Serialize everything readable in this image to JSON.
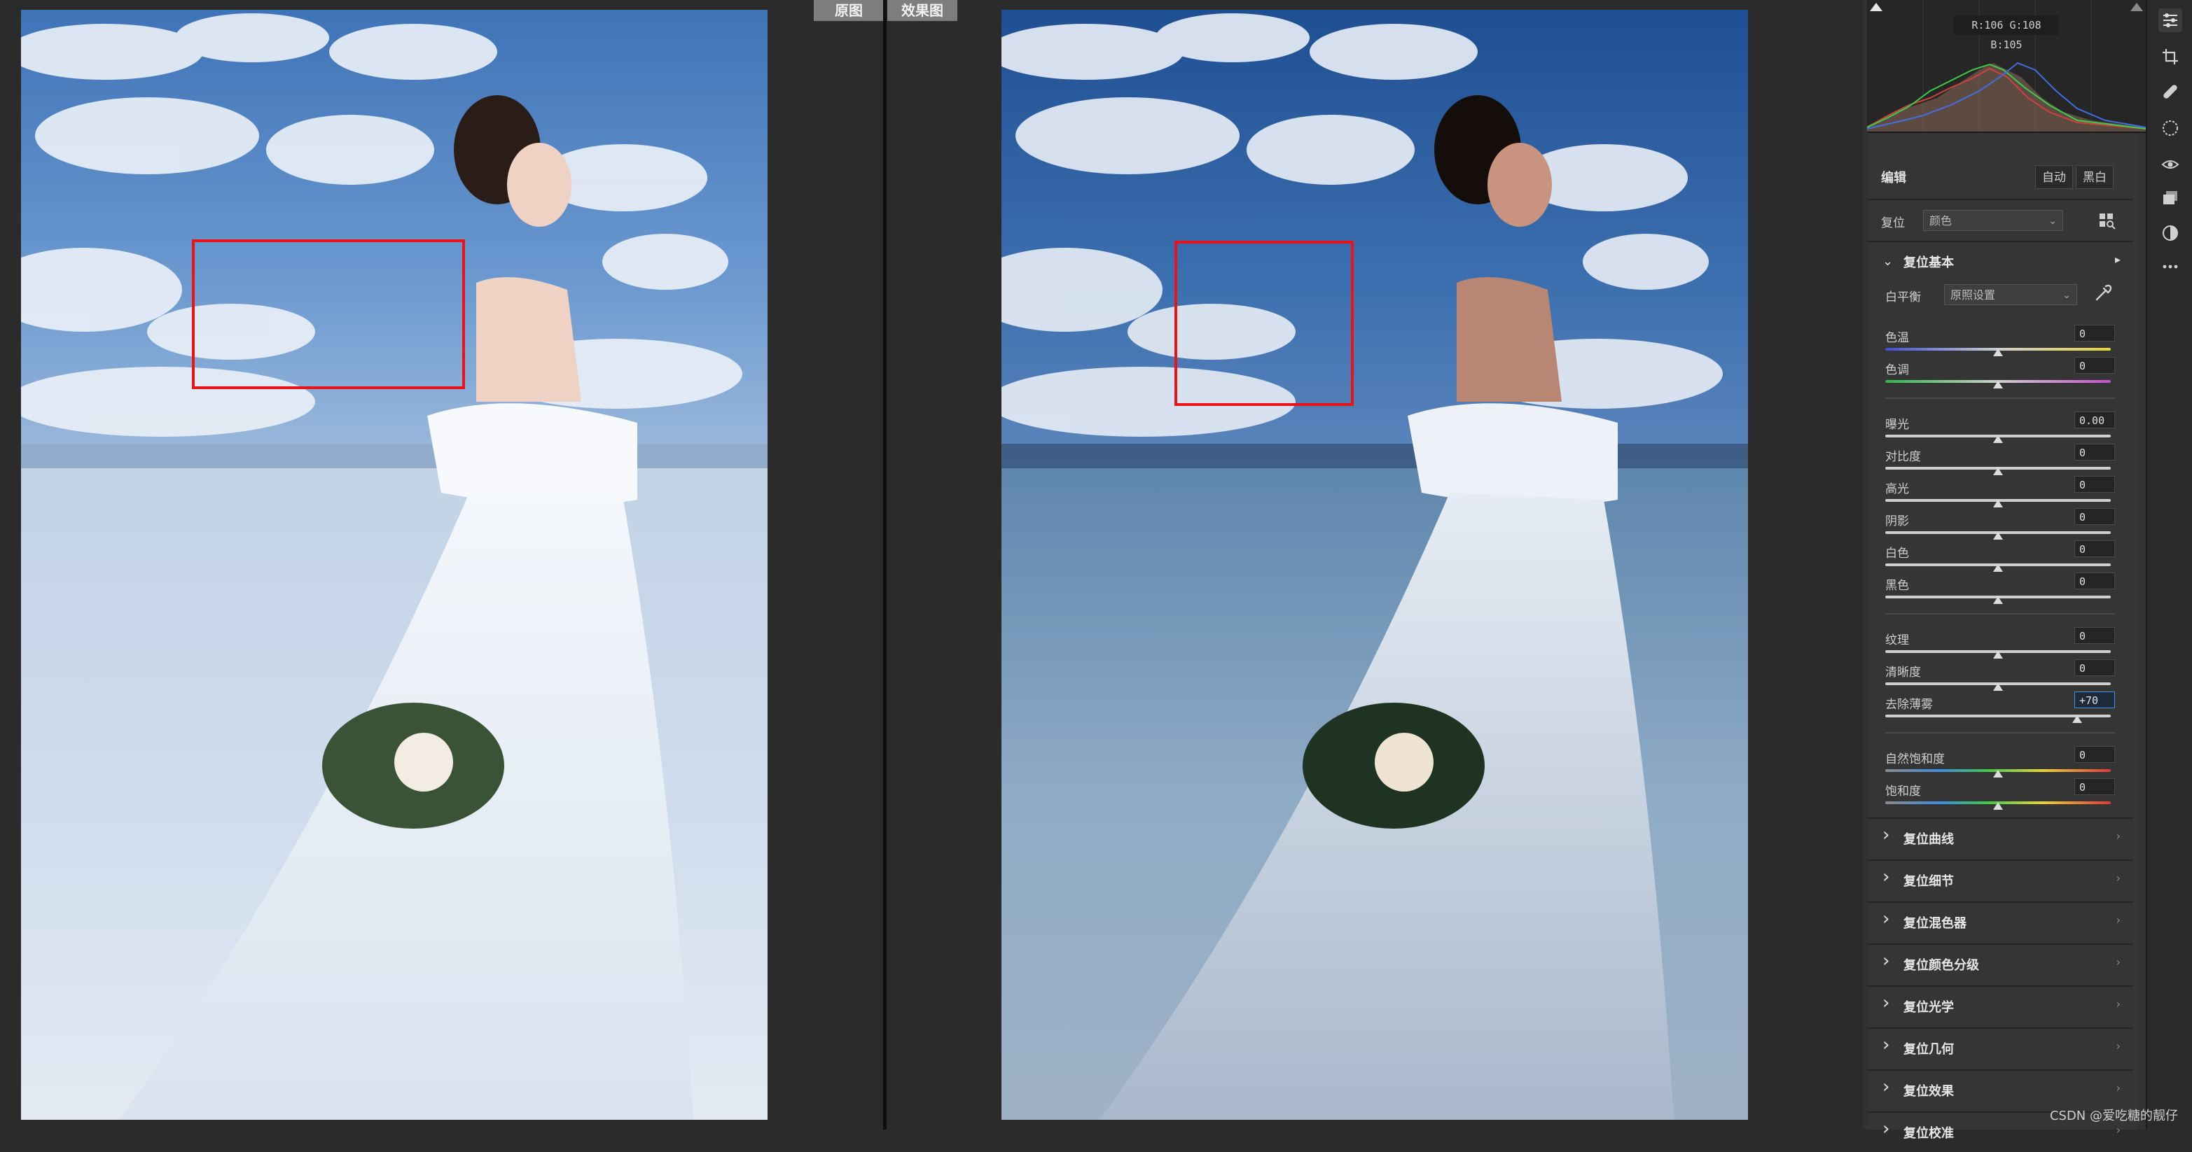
{
  "view": {
    "before_label": "原图",
    "after_label": "效果图"
  },
  "histogram": {
    "rgb_readout": "R:106  G:108  B:105"
  },
  "edit": {
    "title": "编辑",
    "auto_label": "自动",
    "bw_label": "黑白"
  },
  "profile": {
    "label": "复位",
    "value": "颜色"
  },
  "basic": {
    "title": "复位基本",
    "wb_label": "白平衡",
    "wb_value": "原照设置",
    "sliders": [
      {
        "label": "色温",
        "value": "0",
        "level": 0.5,
        "gradient": "temp"
      },
      {
        "label": "色调",
        "value": "0",
        "level": 0.5,
        "gradient": "tint"
      },
      {
        "label": "曝光",
        "value": "0.00",
        "level": 0.5,
        "gradient": "none"
      },
      {
        "label": "对比度",
        "value": "0",
        "level": 0.5,
        "gradient": "none"
      },
      {
        "label": "高光",
        "value": "0",
        "level": 0.5,
        "gradient": "none"
      },
      {
        "label": "阴影",
        "value": "0",
        "level": 0.5,
        "gradient": "none"
      },
      {
        "label": "白色",
        "value": "0",
        "level": 0.5,
        "gradient": "none"
      },
      {
        "label": "黑色",
        "value": "0",
        "level": 0.5,
        "gradient": "none"
      },
      {
        "label": "纹理",
        "value": "0",
        "level": 0.5,
        "gradient": "none"
      },
      {
        "label": "清晰度",
        "value": "0",
        "level": 0.5,
        "gradient": "none"
      },
      {
        "label": "去除薄雾",
        "value": "+70",
        "level": 0.85,
        "gradient": "none",
        "active": true
      },
      {
        "label": "自然饱和度",
        "value": "0",
        "level": 0.5,
        "gradient": "sat"
      },
      {
        "label": "饱和度",
        "value": "0",
        "level": 0.5,
        "gradient": "sat"
      }
    ]
  },
  "sections": [
    {
      "title": "复位曲线"
    },
    {
      "title": "复位细节"
    },
    {
      "title": "复位混色器"
    },
    {
      "title": "复位颜色分级"
    },
    {
      "title": "复位光学"
    },
    {
      "title": "复位几何"
    },
    {
      "title": "复位效果"
    },
    {
      "title": "复位校准"
    }
  ],
  "watermark": "CSDN @爱吃糖的靓仔",
  "colors": {
    "selection_box": "#e8141a",
    "panel_bg": "#353535",
    "active_field": "#4a8fd8"
  },
  "icons": [
    "edit-sliders-icon",
    "crop-icon",
    "healing-icon",
    "mask-icon",
    "redeye-icon",
    "snapshots-icon",
    "presets-icon",
    "more-icon",
    "eyedropper-icon",
    "profile-grid-icon"
  ]
}
